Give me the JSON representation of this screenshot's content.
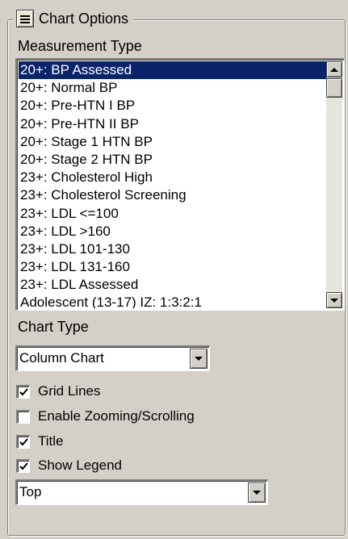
{
  "panel": {
    "title": "Chart Options"
  },
  "measurement": {
    "label": "Measurement Type",
    "selected_index": 0,
    "items": [
      "20+: BP Assessed",
      "20+: Normal BP",
      "20+: Pre-HTN I BP",
      "20+: Pre-HTN II BP",
      "20+: Stage 1 HTN BP",
      "20+: Stage 2 HTN BP",
      "23+: Cholesterol High",
      "23+: Cholesterol Screening",
      "23+: LDL <=100",
      "23+: LDL >160",
      "23+: LDL 101-130",
      "23+: LDL 131-160",
      "23+: LDL Assessed",
      "Adolescent (13-17) IZ: 1:3:2:1"
    ]
  },
  "chart_type": {
    "label": "Chart Type",
    "value": "Column Chart"
  },
  "options": {
    "grid_lines": {
      "label": "Grid Lines",
      "checked": true
    },
    "zooming": {
      "label": "Enable Zooming/Scrolling",
      "checked": false
    },
    "title": {
      "label": "Title",
      "checked": true
    },
    "legend": {
      "label": "Show Legend",
      "checked": true
    }
  },
  "legend_position": {
    "value": "Top"
  },
  "colors": {
    "selection": "#0a246a",
    "face": "#d4d0c8"
  }
}
